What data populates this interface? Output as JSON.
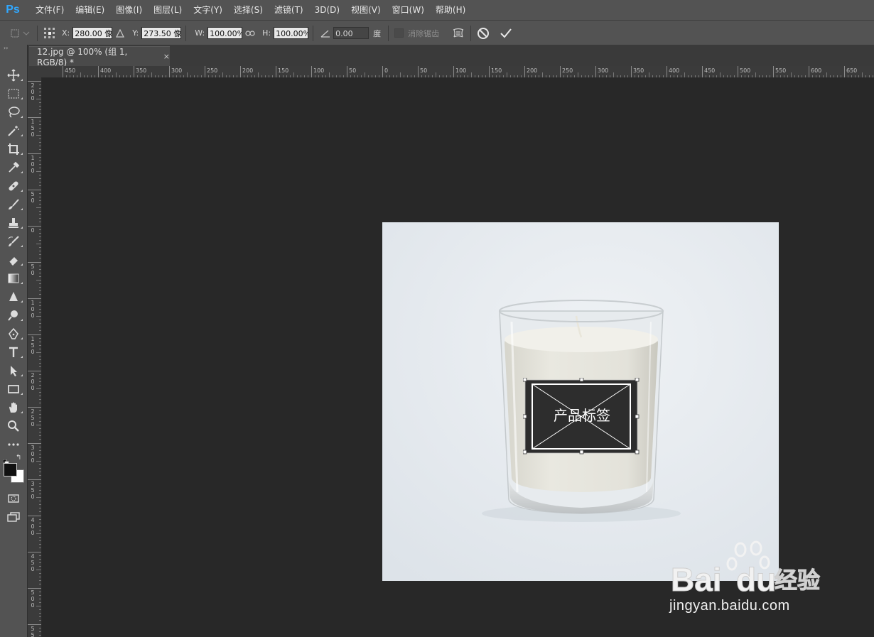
{
  "app": {
    "logo": "Ps"
  },
  "menu": [
    "文件(F)",
    "编辑(E)",
    "图像(I)",
    "图层(L)",
    "文字(Y)",
    "选择(S)",
    "滤镜(T)",
    "3D(D)",
    "视图(V)",
    "窗口(W)",
    "帮助(H)"
  ],
  "options": {
    "x_label": "X:",
    "x_value": "280.00 像素",
    "y_label": "Y:",
    "y_value": "273.50 像素",
    "w_label": "W:",
    "w_value": "100.00%",
    "h_label": "H:",
    "h_value": "100.00%",
    "angle_value": "0.00",
    "angle_unit": "度",
    "antialias_label": "消除锯齿",
    "icons": [
      "move-icon",
      "reference-point-icon",
      "triangle-delta-icon",
      "link-icon",
      "angle-icon",
      "warp-icon",
      "cancel-icon",
      "commit-checkmark-icon"
    ]
  },
  "document_tab": {
    "title": "12.jpg @ 100% (组 1, RGB/8) *",
    "close": "×"
  },
  "rulers": {
    "horizontal": [
      "450",
      "400",
      "350",
      "300",
      "250",
      "200",
      "150",
      "100",
      "50",
      "0",
      "50",
      "100",
      "150",
      "200",
      "250",
      "300",
      "350",
      "400",
      "450",
      "500",
      "550",
      "600",
      "650"
    ],
    "vertical": [
      "200",
      "150",
      "100",
      "50",
      "0",
      "50",
      "100",
      "150",
      "200",
      "250",
      "300",
      "350",
      "400",
      "450",
      "500",
      "550"
    ]
  },
  "tools": [
    "move-tool",
    "marquee-tool",
    "lasso-tool",
    "magic-wand-tool",
    "crop-tool",
    "eyedropper-tool",
    "healing-brush-tool",
    "brush-tool",
    "clone-stamp-tool",
    "history-brush-tool",
    "eraser-tool",
    "gradient-tool",
    "blur-tool",
    "dodge-tool",
    "pen-tool",
    "type-tool",
    "path-selection-tool",
    "rectangle-tool",
    "hand-tool",
    "zoom-tool",
    "more-tools"
  ],
  "colors": {
    "foreground": "#111111",
    "background": "#ffffff",
    "accent": "#31a8ff"
  },
  "canvas": {
    "label_text": "产品标签"
  },
  "watermark": {
    "brand": "Bai",
    "brand2": "du",
    "brand_cn": "经验",
    "url": "jingyan.baidu.com"
  }
}
